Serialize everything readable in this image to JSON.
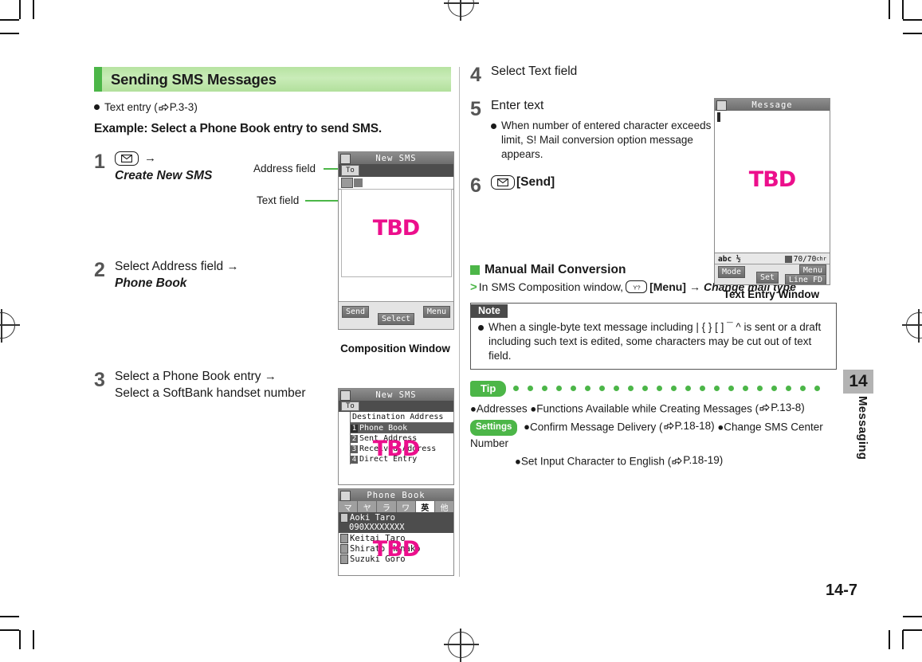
{
  "section": {
    "title": "Sending SMS Messages",
    "accent_green": "#4cb648",
    "header_bg": "#bfe7ad"
  },
  "intro": {
    "bullet": "Text entry (",
    "bullet_ref": "P.3-3",
    "bullet_tail": ")",
    "example": "Example: Select a Phone Book entry to send SMS."
  },
  "steps": [
    {
      "num": "1",
      "key_icon": "mail-key-icon",
      "arrow": "→",
      "line2": "Create New SMS"
    },
    {
      "num": "2",
      "line1": "Select Address field",
      "arrow": "→",
      "line2": "Phone Book"
    },
    {
      "num": "3",
      "line1": "Select a Phone Book entry",
      "arrow": "→",
      "line2": "Select a SoftBank handset number"
    },
    {
      "num": "4",
      "line1": "Select Text field"
    },
    {
      "num": "5",
      "line1": "Enter text",
      "note": "When number of entered character exceeds limit, S! Mail conversion option message appears."
    },
    {
      "num": "6",
      "key_icon": "mail-key-icon",
      "line1": "[Send]"
    }
  ],
  "callouts": {
    "address_field": "Address field",
    "text_field": "Text field"
  },
  "captions": {
    "composition_window": "Composition Window",
    "text_entry_window": "Text Entry Window"
  },
  "screens": {
    "new_sms": {
      "title": "New SMS",
      "to_label": "To",
      "placeholder": "TBD",
      "softkeys": {
        "left": "Send",
        "center": "Select",
        "right": "Menu"
      }
    },
    "destination": {
      "title": "New SMS",
      "to_label": "To",
      "menu_title": "Destination Address",
      "items": [
        {
          "num": "1",
          "label": "Phone Book",
          "selected": true
        },
        {
          "num": "2",
          "label": "Sent Address",
          "selected": false
        },
        {
          "num": "3",
          "label": "Received Address",
          "selected": false
        },
        {
          "num": "4",
          "label": "Direct Entry",
          "selected": false
        }
      ],
      "placeholder": "TBD"
    },
    "phone_book": {
      "title": "Phone Book",
      "tabs": [
        "マ",
        "ヤ",
        "ラ",
        "ワ",
        "英",
        "他"
      ],
      "selected_tab": "英",
      "entries": [
        {
          "name": "Aoki Taro",
          "number": "090XXXXXXXX",
          "selected": true
        },
        {
          "name": "Keitai Taro",
          "number": "",
          "selected": false
        },
        {
          "name": "Shirato Hanako",
          "number": "",
          "selected": false
        },
        {
          "name": "Suzuki Goro",
          "number": "",
          "selected": false
        }
      ],
      "placeholder": "TBD"
    },
    "message": {
      "title": "Message",
      "placeholder": "TBD",
      "input_mode": "abc ½",
      "counter": "70/70",
      "counter_unit": "chr",
      "softkeys": {
        "left": "Mode",
        "center": "Set",
        "right_top": "Menu",
        "right_bottom": "Line FD"
      }
    }
  },
  "manual": {
    "heading": "Manual Mail Conversion",
    "op_prefix": "In SMS Composition window,",
    "op_key": "menu-key-icon",
    "op_menu": "[Menu]",
    "op_arrow": "→",
    "op_target": "Change mail type"
  },
  "note": {
    "tag": "Note",
    "text": "When a single-byte text message including | { } [ ] ¯ ^ is sent or a draft including such text is edited, some characters may be cut out of text field."
  },
  "tip": {
    "tag": "Tip",
    "line1_a": "Addresses",
    "line1_b": "Functions Available while Creating Messages (",
    "line1_ref": "P.13-8",
    "line1_c": ")",
    "settings_tag": "Settings",
    "line2_a": "Confirm Message Delivery (",
    "line2_ref": "P.18-18",
    "line2_b": ")",
    "line2_c": "Change SMS Center Number",
    "line3_a": "Set Input Character to English (",
    "line3_ref": "P.18-19",
    "line3_b": ")"
  },
  "chapter": {
    "number": "14",
    "name": "Messaging",
    "page": "14-7"
  }
}
